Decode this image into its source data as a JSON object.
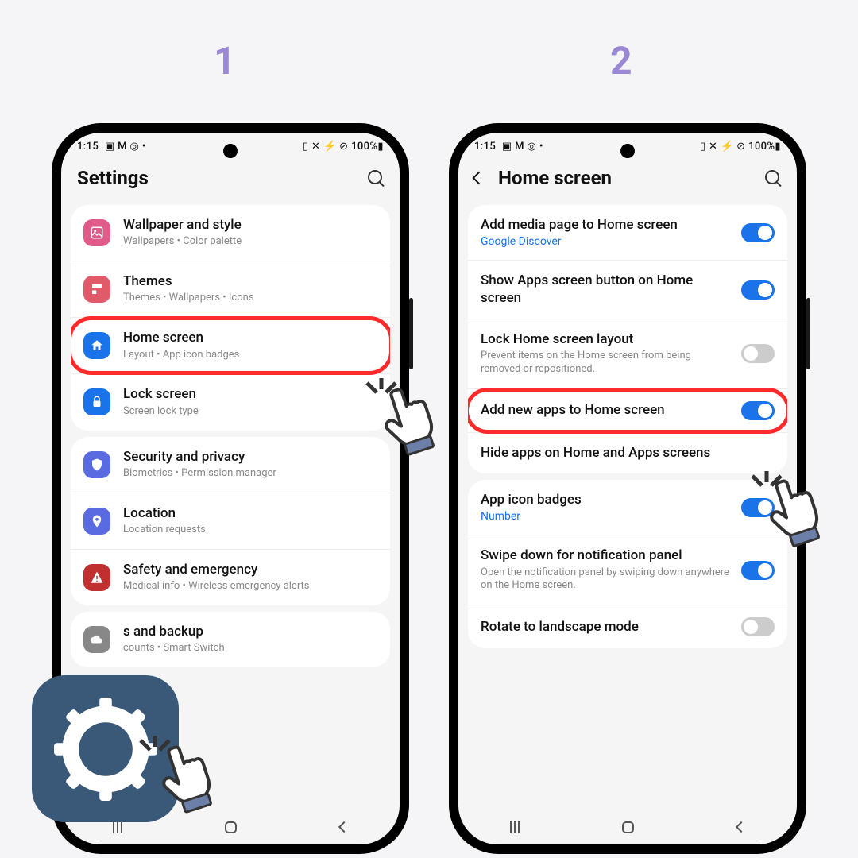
{
  "steps": {
    "one": "1",
    "two": "2"
  },
  "status": {
    "time": "1:15",
    "icons": "▣ M ◎ •",
    "right": "▯ ✕ ⚡ ⊘ 100%▮"
  },
  "p1": {
    "title": "Settings",
    "groups": [
      {
        "rows": [
          {
            "icon": "#e05a8a",
            "t": "Wallpaper and style",
            "s": "Wallpapers  •  Color palette"
          },
          {
            "icon": "#e05a6a",
            "t": "Themes",
            "s": "Themes  •  Wallpapers  •  Icons"
          },
          {
            "icon": "#1a73e8",
            "t": "Home screen",
            "s": "Layout  •  App icon badges",
            "hl": true
          },
          {
            "icon": "#1a73e8",
            "t": "Lock screen",
            "s": "Screen lock type"
          }
        ]
      },
      {
        "rows": [
          {
            "icon": "#5a6ae0",
            "t": "Security and privacy",
            "s": "Biometrics  •  Permission manager"
          },
          {
            "icon": "#5a6ae0",
            "t": "Location",
            "s": "Location requests"
          },
          {
            "icon": "#c03030",
            "t": "Safety and emergency",
            "s": "Medical info  •  Wireless emergency alerts"
          }
        ]
      },
      {
        "rows": [
          {
            "icon": "#888",
            "t": "s and backup",
            "s": "counts  •  Smart Switch"
          }
        ]
      }
    ]
  },
  "p2": {
    "title": "Home screen",
    "groups": [
      {
        "rows": [
          {
            "t": "Add media page to Home screen",
            "link": "Google Discover",
            "sw": "on"
          },
          {
            "t": "Show Apps screen button on Home screen",
            "sw": "on"
          },
          {
            "t": "Lock Home screen layout",
            "s": "Prevent items on the Home screen from being removed or repositioned.",
            "sw": "off"
          },
          {
            "t": "Add new apps to Home screen",
            "sw": "on",
            "hl": true
          },
          {
            "t": "Hide apps on Home and Apps screens"
          }
        ]
      },
      {
        "rows": [
          {
            "t": "App icon badges",
            "link": "Number",
            "sw": "on"
          },
          {
            "t": "Swipe down for notification panel",
            "s": "Open the notification panel by swiping down anywhere on the Home screen.",
            "sw": "on"
          },
          {
            "t": "Rotate to landscape mode",
            "sw": "off"
          }
        ]
      }
    ]
  }
}
